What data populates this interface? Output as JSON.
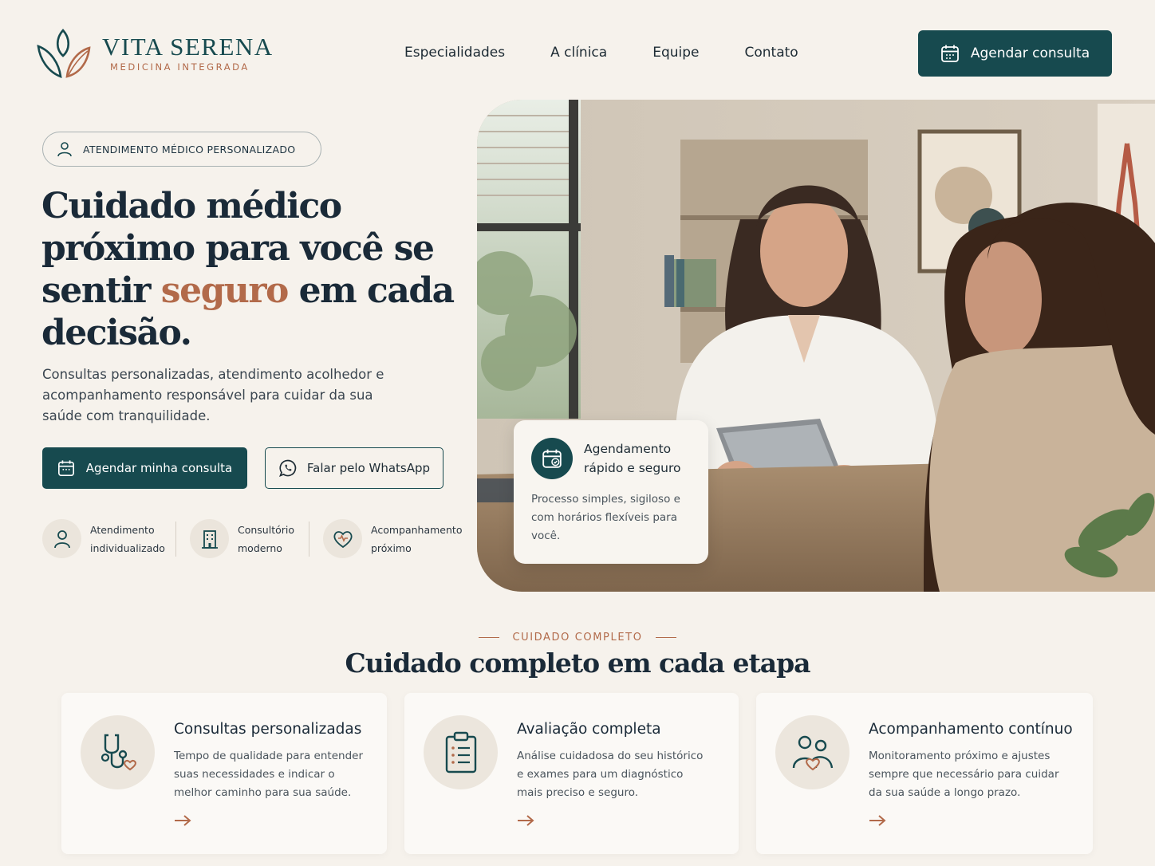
{
  "header": {
    "logo_name": "VITA SERENA",
    "logo_tagline": "MEDICINA INTEGRADA",
    "nav": [
      "Especialidades",
      "A clínica",
      "Equipe",
      "Contato"
    ],
    "cta_label": "Agendar consulta"
  },
  "hero": {
    "badge": "ATENDIMENTO MÉDICO PERSONALIZADO",
    "title_part1": "Cuidado médico próximo para você se sentir ",
    "title_accent": "seguro",
    "title_part2": " em cada decisão.",
    "description": "Consultas personalizadas, atendimento acolhedor e acompanhamento responsável para cuidar da sua saúde com tranquilidade.",
    "primary_button": "Agendar minha consulta",
    "secondary_button": "Falar pelo WhatsApp",
    "features": [
      {
        "line1": "Atendimento",
        "line2": "individualizado",
        "icon": "person-icon"
      },
      {
        "line1": "Consultório",
        "line2": "moderno",
        "icon": "building-icon"
      },
      {
        "line1": "Acompanhamento",
        "line2": "próximo",
        "icon": "heart-icon"
      }
    ],
    "info_card": {
      "title_line1": "Agendamento",
      "title_line2": "rápido e seguro",
      "description": "Processo simples, sigiloso e com horários flexíveis para você."
    }
  },
  "section": {
    "eyebrow": "CUIDADO COMPLETO",
    "title": "Cuidado completo em cada etapa",
    "cards": [
      {
        "title": "Consultas personalizadas",
        "description": "Tempo de qualidade para entender suas necessidades e indicar o melhor caminho para sua saúde.",
        "icon": "stethoscope-icon"
      },
      {
        "title": "Avaliação completa",
        "description": "Análise cuidadosa do seu histórico e exames para um diagnóstico mais preciso e seguro.",
        "icon": "clipboard-icon"
      },
      {
        "title": "Acompanhamento contínuo",
        "description": "Monitoramento próximo e ajustes sempre que necessário para cuidar da sua saúde a longo prazo.",
        "icon": "people-heart-icon"
      }
    ]
  },
  "colors": {
    "primary": "#174a4f",
    "accent": "#b26a4a",
    "background": "#f6f2ec",
    "text": "#1a2a38"
  }
}
